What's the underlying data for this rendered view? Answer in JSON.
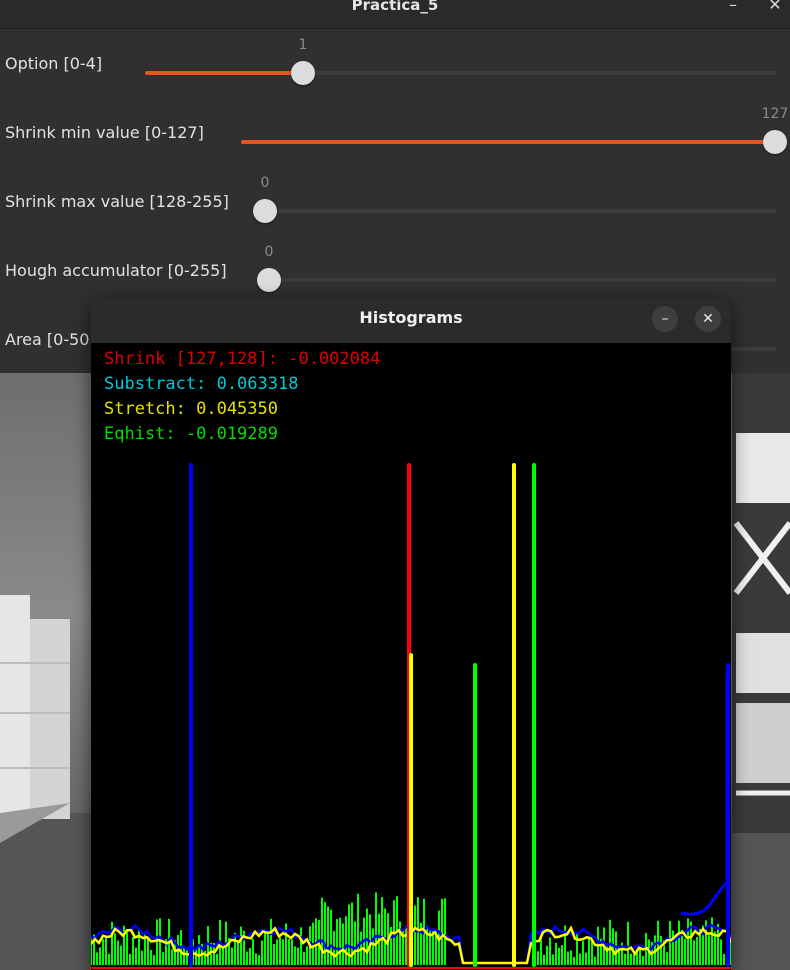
{
  "window": {
    "title": "Practica_5",
    "minimize_glyph": "–",
    "close_glyph": "✕"
  },
  "trackbars": [
    {
      "label": "Option [0-4]",
      "value": "1",
      "fraction": 0.25
    },
    {
      "label": "Shrink min value [0-127]",
      "value": "127",
      "fraction": 1.0
    },
    {
      "label": "Shrink max value [128-255]",
      "value": "0",
      "fraction": 0.0
    },
    {
      "label": "Hough accumulator [0-255]",
      "value": "0",
      "fraction": 0.0
    },
    {
      "label": "Area [0-50",
      "value": "",
      "fraction": 0.0
    }
  ],
  "accent_color": "#e95420",
  "histograms": {
    "title": "Histograms",
    "minimize_glyph": "–",
    "close_glyph": "✕",
    "lines": [
      {
        "text": "Shrink [127,128]: -0.002084",
        "color": "#e00000"
      },
      {
        "text": "Substract: 0.063318",
        "color": "#00c8d8"
      },
      {
        "text": "Stretch: 0.045350",
        "color": "#e8e000"
      },
      {
        "text": "Eqhist: -0.019289",
        "color": "#00dd00"
      }
    ],
    "series_colors": {
      "blue": "#0000ff",
      "red": "#ff0000",
      "yellow": "#ffff00",
      "green": "#00ff00"
    },
    "peaks": [
      {
        "color": "blue",
        "bin": 100,
        "height": 1.0
      },
      {
        "color": "red",
        "bin": 318,
        "height": 1.0
      },
      {
        "color": "yellow",
        "bin": 320,
        "height": 0.62
      },
      {
        "color": "green",
        "bin": 384,
        "height": 0.6
      },
      {
        "color": "yellow",
        "bin": 423,
        "height": 1.0
      },
      {
        "color": "green",
        "bin": 443,
        "height": 1.0
      },
      {
        "color": "blue",
        "bin": 637,
        "height": 0.6
      }
    ]
  }
}
